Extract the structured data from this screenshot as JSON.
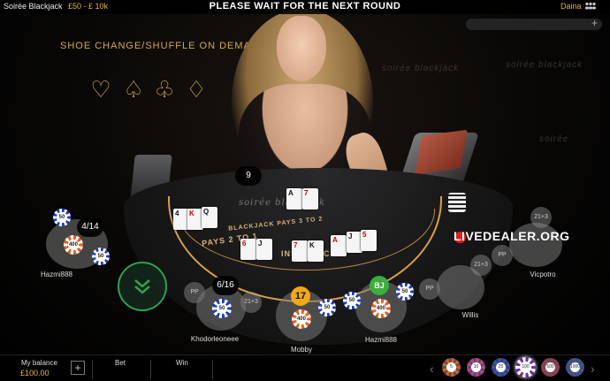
{
  "topbar": {
    "game_name": "Soirée Blackjack",
    "limits": "£50 - £ 10k",
    "status": "PLEASE WAIT FOR THE NEXT ROUND",
    "username": "Daina"
  },
  "wall": {
    "shoe_text": "SHOE CHANGE/SHUFFLE ON DEMAND",
    "brand": "soirée blackjack",
    "brand_small": "soirée"
  },
  "table": {
    "logo": "soirée blackjack",
    "pays": "PAYS 2 TO 1",
    "insurance": "INSURANCE",
    "blackjack": "BLACKJACK PAYS 3 TO 2",
    "dealer_count": "9"
  },
  "seats": [
    {
      "name": "Hazmi888",
      "count": "4/14",
      "chip": "400"
    },
    {
      "name": "Khodorleoneee",
      "count": "6/16",
      "chip": "50"
    },
    {
      "name": "Mobby",
      "score": "17",
      "chip": "400"
    },
    {
      "name": "Hazmi888",
      "score": "BJ",
      "chip": "400"
    },
    {
      "name": "Willis"
    },
    {
      "name": "Vicpotro"
    }
  ],
  "chip_labels": {
    "c50": "50",
    "c400": "400"
  },
  "sidebets": {
    "pp": "PP",
    "s21": "21+3"
  },
  "watermark": "LIVEDEALER.ORG",
  "bottombar": {
    "balance_label": "My balance",
    "balance_value": "£100.00",
    "bet_label": "Bet",
    "win_label": "Win",
    "chips": [
      "5",
      "10",
      "25",
      "100",
      "500",
      "1000"
    ]
  },
  "colors": {
    "accent": "#e0b64a",
    "expand": "#2fa04f",
    "bj": "#3cae3c",
    "score": "#f2a818"
  }
}
